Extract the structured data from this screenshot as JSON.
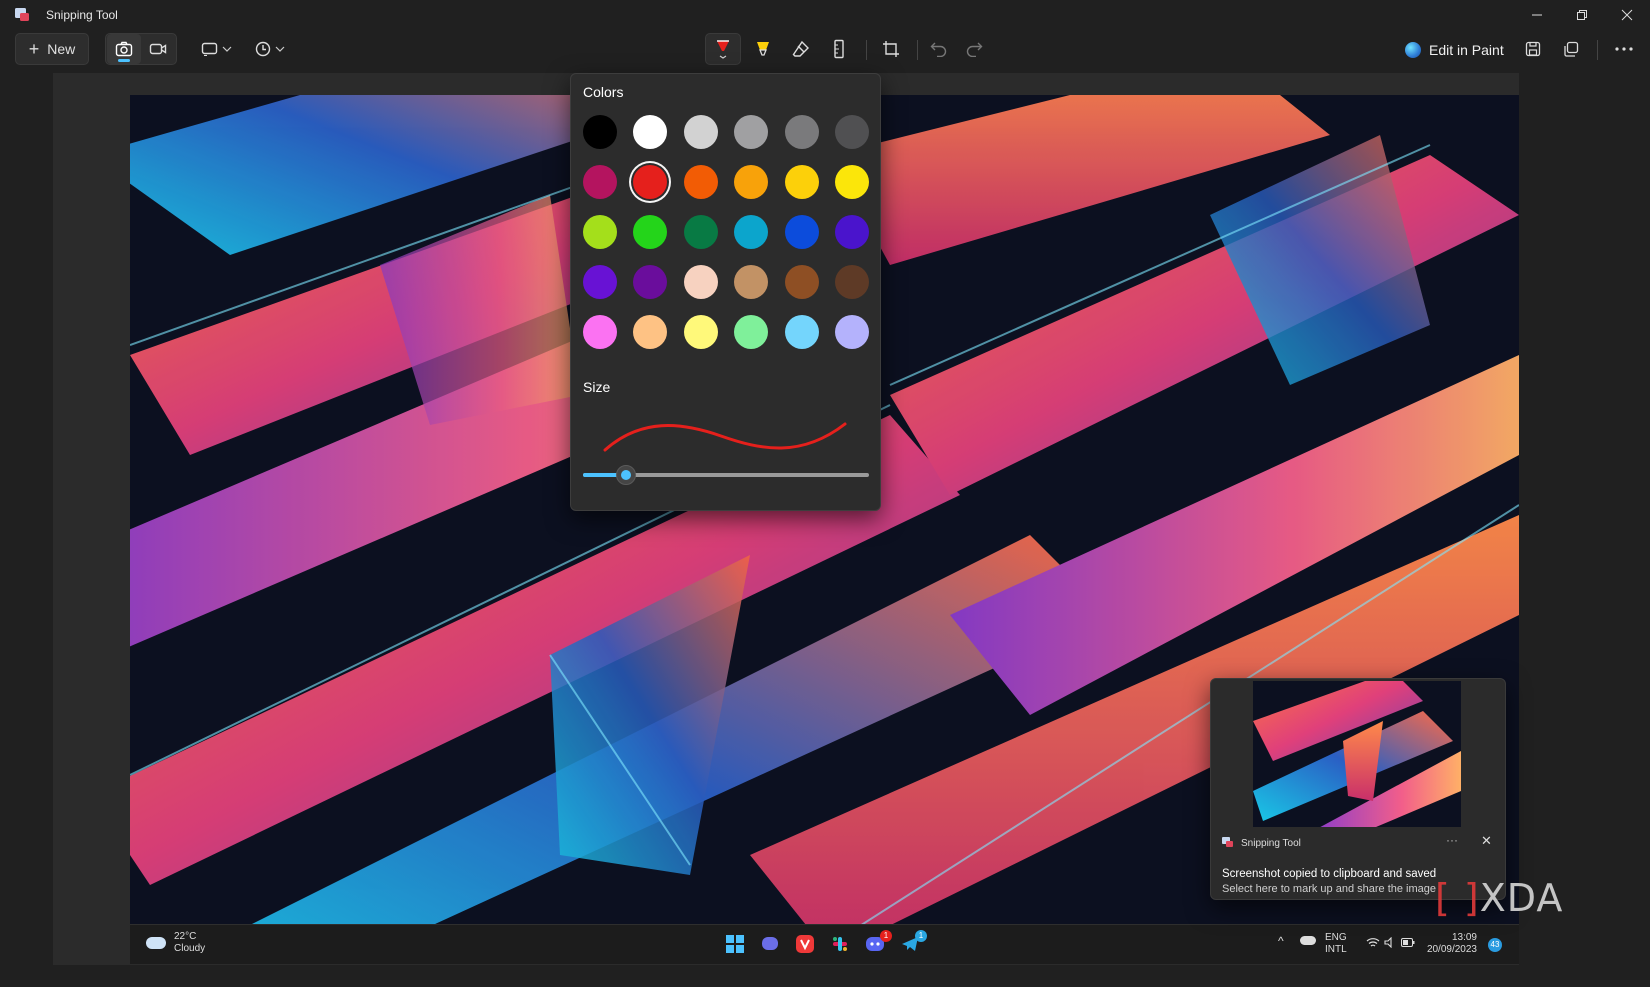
{
  "window": {
    "title": "Snipping Tool"
  },
  "toolbar": {
    "new_label": "New",
    "edit_in_paint_label": "Edit in Paint",
    "icons": [
      "camera-icon",
      "video-icon",
      "snip-mode-icon",
      "delay-icon",
      "ballpoint-pen-icon",
      "highlighter-icon",
      "eraser-icon",
      "ruler-icon",
      "crop-icon",
      "undo-icon",
      "redo-icon",
      "save-icon",
      "copy-icon",
      "more-icon"
    ],
    "accent_color": "#4cc2ff"
  },
  "pen_popup": {
    "colors_title": "Colors",
    "size_title": "Size",
    "selected_color": "#e5201c",
    "size_value_fraction": 0.15,
    "swatches": [
      "#000000",
      "#ffffff",
      "#d2d2d2",
      "#a0a0a2",
      "#7a7a7c",
      "#505052",
      "#b4145f",
      "#e5201c",
      "#f25c05",
      "#f8a20a",
      "#fcd00a",
      "#fbe60a",
      "#a4df1b",
      "#24d41a",
      "#087a44",
      "#0ca5cc",
      "#0c4cdc",
      "#4a14cc",
      "#6812d4",
      "#6a0d9c",
      "#f7d2c0",
      "#c29265",
      "#8e4f24",
      "#5e3a26",
      "#fb72f2",
      "#fec284",
      "#fff97a",
      "#7ff09a",
      "#74d5fc",
      "#b4b2fc"
    ]
  },
  "taskbar": {
    "temperature": "22°C",
    "condition": "Cloudy",
    "lang_top": "ENG",
    "lang_bottom": "INTL",
    "time": "13:09",
    "date": "20/09/2023",
    "discord_badge": "1",
    "telegram_badge": "1",
    "notification_count": "43"
  },
  "toast": {
    "source": "Snipping Tool",
    "more": "···",
    "close": "✕",
    "message": "Screenshot copied to clipboard and saved",
    "hint": "Select here to mark up and share the image"
  },
  "watermark": {
    "text": "XDA"
  }
}
